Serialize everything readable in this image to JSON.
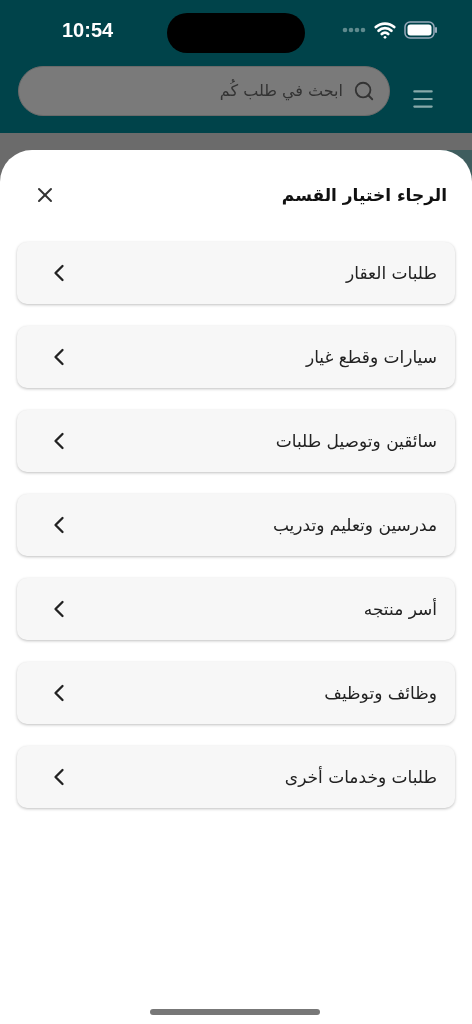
{
  "status_bar": {
    "time": "10:54"
  },
  "search": {
    "placeholder": "ابحث في طلب كُم"
  },
  "sheet": {
    "title": "الرجاء اختيار القسم",
    "categories": [
      {
        "label": "طلبات العقار"
      },
      {
        "label": "سيارات وقطع غيار"
      },
      {
        "label": "سائقين وتوصيل طلبات"
      },
      {
        "label": "مدرسين وتعليم وتدريب"
      },
      {
        "label": "أسر منتجه"
      },
      {
        "label": "وظائف وتوظيف"
      },
      {
        "label": "طلبات وخدمات أخرى"
      }
    ]
  }
}
